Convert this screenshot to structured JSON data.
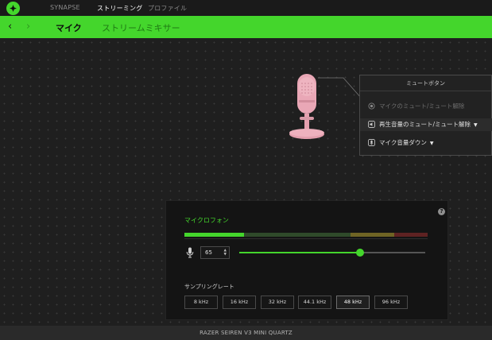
{
  "top_tabs": [
    "SYNAPSE",
    "ストリーミング",
    "プロファイル"
  ],
  "sub_tabs": [
    "マイク",
    "ストリームミキサー"
  ],
  "mute_panel": {
    "title": "ミュートボタン",
    "options": [
      "マイクのミュート/ミュート解除",
      "再生音量のミュート/ミュート解除",
      "マイク音量ダウン"
    ]
  },
  "mic_panel": {
    "title": "マイクロフォン",
    "help": "?",
    "volume": 65,
    "volume_max": 100,
    "sample_rate_label": "サンプリングレート",
    "sample_rates": [
      "8 kHz",
      "16 kHz",
      "32 kHz",
      "44.1 kHz",
      "48 kHz",
      "96 kHz"
    ],
    "selected_sample_rate": "48 kHz"
  },
  "device_name": "RAZER SEIREN V3 MINI QUARTZ",
  "colors": {
    "accent": "#44d62c",
    "mic_pink": "#e9a7b6",
    "level_yellow": "#8a7a2a",
    "level_red": "#7a2626"
  }
}
